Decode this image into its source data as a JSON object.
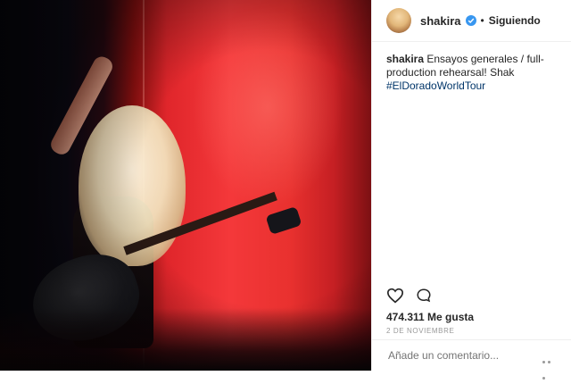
{
  "post": {
    "username": "shakira",
    "follow_status": "Siguiendo",
    "caption_user": "shakira",
    "caption_text": "Ensayos generales / full-production rehearsal! Shak",
    "hashtag": "#ElDoradoWorldTour",
    "likes": "474.311 Me gusta",
    "date": "2 DE NOVIEMBRE",
    "comment_placeholder": "Añade un comentario..."
  },
  "icons": {
    "verified": "verified-badge-icon",
    "like": "heart-icon",
    "comment": "speech-bubble-icon",
    "more": "ellipsis-icon"
  },
  "colors": {
    "accent": "#3897f0",
    "hashtag": "#003569",
    "stage_red": "#e0262b"
  }
}
